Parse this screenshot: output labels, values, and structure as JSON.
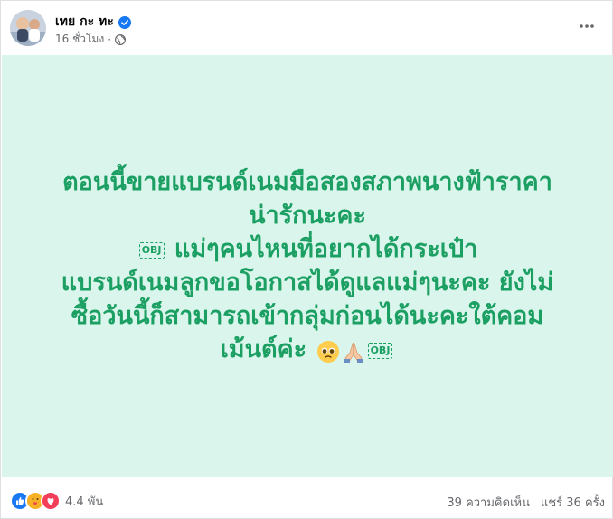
{
  "post": {
    "author": "เทย กะ ทะ",
    "timestamp": "16 ชั่วโมง",
    "separator": "·",
    "text_lines": {
      "l1": "ตอนนี้ขายแบรนด์เนมมือสองสภาพนางฟ้าราคา",
      "l2": "น่ารักนะคะ",
      "l3_obj": "OBJ",
      "l3": "แม่ๆคนไหนที่อยากได้กระเป๋า",
      "l4": "แบรนด์เนมลูกขอโอกาสได้ดูแลแม่ๆนะคะ ยังไม่",
      "l5": "ซื้อวันนี้ก็สามารถเข้ากลุ่มก่อนได้นะคะใต้คอม",
      "l6": "เม้นต์ค่ะ",
      "l6_obj": "OBJ"
    },
    "background_color": "#d9f5ec",
    "text_color": "#1c9f62"
  },
  "footer": {
    "reaction_icons": [
      "like-icon",
      "care-icon",
      "love-icon"
    ],
    "reaction_count": "4.4 พัน",
    "comments": "39 ความคิดเห็น",
    "shares": "แชร์ 36 ครั้ง"
  }
}
